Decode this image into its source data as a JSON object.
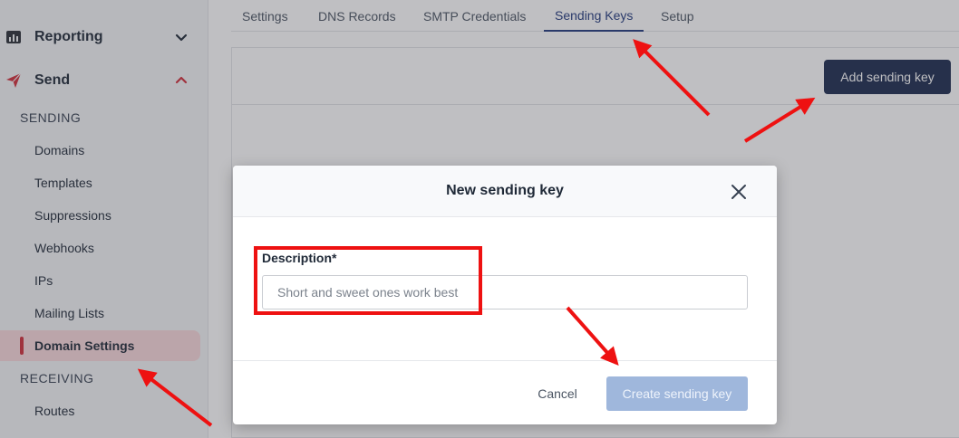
{
  "sidebar": {
    "reporting": {
      "label": "Reporting",
      "icon": "bar-chart-icon"
    },
    "send": {
      "label": "Send",
      "icon": "paper-plane-icon"
    },
    "sending_header": "SENDING",
    "sending_items": [
      {
        "label": "Domains"
      },
      {
        "label": "Templates"
      },
      {
        "label": "Suppressions"
      },
      {
        "label": "Webhooks"
      },
      {
        "label": "IPs"
      },
      {
        "label": "Mailing Lists"
      },
      {
        "label": "Domain Settings",
        "active": true
      }
    ],
    "receiving_header": "RECEIVING",
    "receiving_items": [
      {
        "label": "Routes"
      }
    ]
  },
  "tabs": [
    {
      "label": "Settings"
    },
    {
      "label": "DNS Records"
    },
    {
      "label": "SMTP Credentials"
    },
    {
      "label": "Sending Keys",
      "active": true
    },
    {
      "label": "Setup"
    }
  ],
  "panel": {
    "add_button": "Add sending key"
  },
  "modal": {
    "title": "New sending key",
    "description_label": "Description*",
    "description_placeholder": "Short and sweet ones work best",
    "description_value": "",
    "cancel_label": "Cancel",
    "create_label": "Create sending key"
  },
  "colors": {
    "accent_red": "#d12e3a",
    "primary_navy": "#1b2a4e",
    "tab_active": "#21397d",
    "create_disabled": "#9fb7dc",
    "annotation": "#ee1111"
  }
}
